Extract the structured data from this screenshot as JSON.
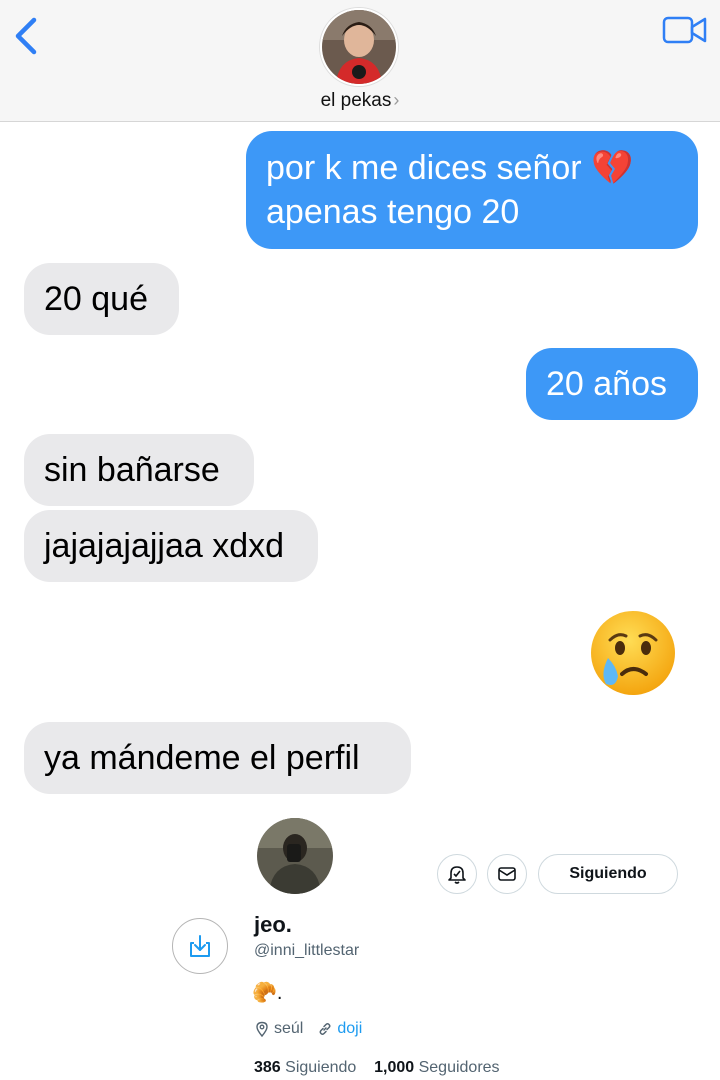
{
  "header": {
    "contact_name": "el pekas",
    "chevron": "›"
  },
  "messages": [
    {
      "from": "me",
      "lines": [
        "por k me dices señor 💔",
        "apenas tengo 20"
      ]
    },
    {
      "from": "them",
      "text": "20 qué"
    },
    {
      "from": "me",
      "text": "20 años"
    },
    {
      "from": "them",
      "text": "sin bañarse"
    },
    {
      "from": "them",
      "text": "jajajajajjaa xdxd"
    },
    {
      "from": "me",
      "emoji": "crying-face"
    },
    {
      "from": "them",
      "text": "ya mándeme el perfil"
    }
  ],
  "profile": {
    "name": "jeo.",
    "handle": "@inni_littlestar",
    "bio": "🥐.",
    "location": "seúl",
    "link": "doji",
    "following_count": "386",
    "following_label": "Siguiendo",
    "followers_count": "1,000",
    "followers_label": "Seguidores",
    "follow_button": "Siguiendo"
  },
  "colors": {
    "outgoing": "#3d98f7",
    "incoming": "#e9e9eb",
    "ios_blue": "#2f7ff5",
    "link": "#1d9bf0"
  },
  "icons": [
    "back-chevron-icon",
    "video-camera-icon",
    "bell-icon",
    "mail-icon",
    "download-icon",
    "location-pin-icon",
    "link-icon"
  ]
}
